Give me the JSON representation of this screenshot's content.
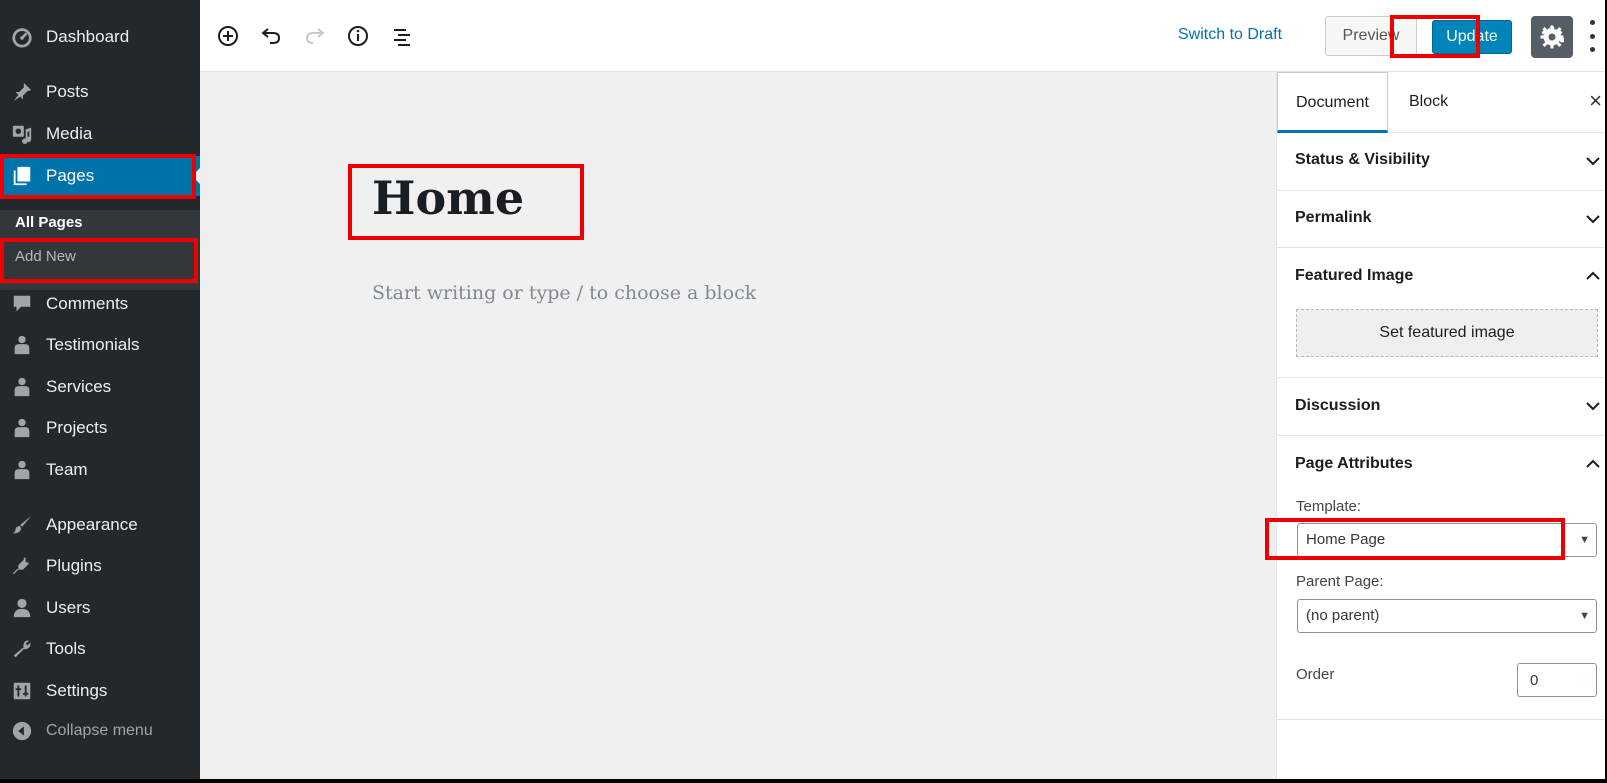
{
  "sidebar": {
    "items": [
      {
        "label": "Dashboard",
        "icon": "dashboard-icon"
      },
      {
        "label": "Posts",
        "icon": "pin-icon"
      },
      {
        "label": "Media",
        "icon": "media-icon"
      },
      {
        "label": "Pages",
        "icon": "pages-icon"
      },
      {
        "label": "Comments",
        "icon": "comment-icon"
      },
      {
        "label": "Testimonials",
        "icon": "user-icon"
      },
      {
        "label": "Services",
        "icon": "user-icon"
      },
      {
        "label": "Projects",
        "icon": "user-icon"
      },
      {
        "label": "Team",
        "icon": "user-icon"
      },
      {
        "label": "Appearance",
        "icon": "paintbrush-icon"
      },
      {
        "label": "Plugins",
        "icon": "plugin-icon"
      },
      {
        "label": "Users",
        "icon": "users-icon"
      },
      {
        "label": "Tools",
        "icon": "wrench-icon"
      },
      {
        "label": "Settings",
        "icon": "settings-icon"
      },
      {
        "label": "Collapse menu",
        "icon": "collapse-icon"
      }
    ],
    "submenu": {
      "all_pages": "All Pages",
      "add_new": "Add New"
    }
  },
  "toolbar": {
    "switch_to_draft": "Switch to Draft",
    "preview": "Preview",
    "update": "Update"
  },
  "editor": {
    "title": "Home",
    "placeholder": "Start writing or type / to choose a block"
  },
  "settings": {
    "tabs": [
      "Document",
      "Block"
    ],
    "close": "×",
    "panels": {
      "status": "Status & Visibility",
      "permalink": "Permalink",
      "featured": "Featured Image",
      "featured_button": "Set featured image",
      "discussion": "Discussion",
      "attributes": "Page Attributes"
    },
    "template_label": "Template:",
    "template_value": "Home Page",
    "parent_label": "Parent Page:",
    "parent_value": "(no parent)",
    "order_label": "Order",
    "order_value": "0"
  },
  "colors": {
    "sidebar_bg": "#23282d",
    "accent": "#0073aa",
    "update_bg": "#0085ba",
    "highlight": "#ee0000"
  }
}
